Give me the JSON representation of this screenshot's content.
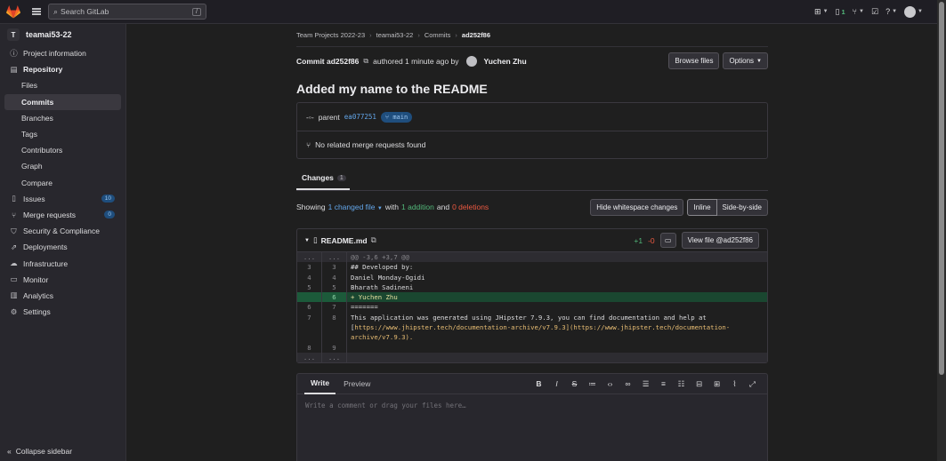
{
  "topbar": {
    "search_placeholder": "Search GitLab",
    "search_shortcut": "/",
    "issues_count": "1",
    "icons": [
      "gitlab-logo",
      "hamburger",
      "search",
      "plus",
      "issues",
      "merge-request",
      "todo",
      "help",
      "avatar"
    ]
  },
  "sidebar": {
    "project_initial": "T",
    "project_name": "teamai53-22",
    "items": [
      {
        "label": "Project information",
        "icon": "info"
      },
      {
        "label": "Repository",
        "icon": "book"
      },
      {
        "label": "Files"
      },
      {
        "label": "Commits"
      },
      {
        "label": "Branches"
      },
      {
        "label": "Tags"
      },
      {
        "label": "Contributors"
      },
      {
        "label": "Graph"
      },
      {
        "label": "Compare"
      },
      {
        "label": "Issues",
        "icon": "issues",
        "count": "10"
      },
      {
        "label": "Merge requests",
        "icon": "merge-request",
        "count": "0"
      },
      {
        "label": "Security & Compliance",
        "icon": "shield"
      },
      {
        "label": "Deployments",
        "icon": "rocket"
      },
      {
        "label": "Infrastructure",
        "icon": "cloud"
      },
      {
        "label": "Monitor",
        "icon": "monitor"
      },
      {
        "label": "Analytics",
        "icon": "chart"
      },
      {
        "label": "Settings",
        "icon": "gear"
      }
    ],
    "collapse_label": "Collapse sidebar"
  },
  "breadcrumb": [
    "Team Projects 2022-23",
    "teamai53-22",
    "Commits",
    "ad252f86"
  ],
  "commit": {
    "label": "Commit ad252f86",
    "authored": "authored 1 minute ago by",
    "author": "Yuchen Zhu",
    "browse_files": "Browse files",
    "options": "Options",
    "title": "Added my name to the README",
    "parent_label": "parent",
    "parent_sha": "ea077251",
    "branch": "main",
    "no_mr": "No related merge requests found"
  },
  "changes": {
    "tab_label": "Changes",
    "tab_count": "1",
    "showing": "Showing",
    "changed_file": "1 changed file",
    "with": "with",
    "additions": "1 addition",
    "and": "and",
    "deletions": "0 deletions",
    "hide_whitespace": "Hide whitespace changes",
    "inline": "Inline",
    "side_by_side": "Side-by-side"
  },
  "file": {
    "name": "README.md",
    "plus": "+1",
    "minus": "-0",
    "view_file": "View file @ad252f86",
    "lines": [
      {
        "old": "...",
        "new": "...",
        "text": "@@ -3,6 +3,7 @@",
        "type": "hunk"
      },
      {
        "old": "3",
        "new": "3",
        "text": "## Developed by:",
        "type": "ctx"
      },
      {
        "old": "4",
        "new": "4",
        "text": "Daniel Monday-Ogidi",
        "type": "ctx"
      },
      {
        "old": "5",
        "new": "5",
        "text": "Bharath Sadineni",
        "type": "ctx"
      },
      {
        "old": "",
        "new": "6",
        "text": "+ Yuchen Zhu",
        "type": "add"
      },
      {
        "old": "6",
        "new": "7",
        "text": "=======",
        "type": "ctx"
      },
      {
        "old": "7",
        "new": "8",
        "text": "This application was generated using JHipster 7.9.3, you can find documentation and help at",
        "type": "ctx"
      },
      {
        "old": "",
        "new": "",
        "text_a": "[",
        "text_link": "https://www.jhipster.tech/documentation-archive/v7.9.3",
        "text_b": "](https://www.jhipster.tech/documentation-archive/v7.9.3).",
        "type": "wrap"
      },
      {
        "old": "8",
        "new": "9",
        "text": "",
        "type": "ctx"
      },
      {
        "old": "...",
        "new": "...",
        "text": "",
        "type": "hunk"
      }
    ]
  },
  "editor": {
    "write": "Write",
    "preview": "Preview",
    "placeholder": "Write a comment or drag your files here…"
  }
}
